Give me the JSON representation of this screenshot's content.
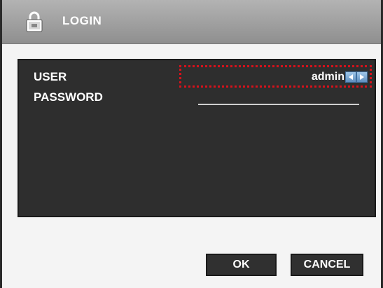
{
  "dialog": {
    "title": "LOGIN",
    "icon": "lock-icon"
  },
  "form": {
    "user_label": "USER",
    "user_value": "admin",
    "password_label": "PASSWORD",
    "password_value": ""
  },
  "buttons": {
    "ok_label": "OK",
    "cancel_label": "CANCEL"
  },
  "colors": {
    "titlebar": "#9f9f9f",
    "panel": "#2e2e2e",
    "focus_border": "#d7111b",
    "text": "#ffffff"
  }
}
